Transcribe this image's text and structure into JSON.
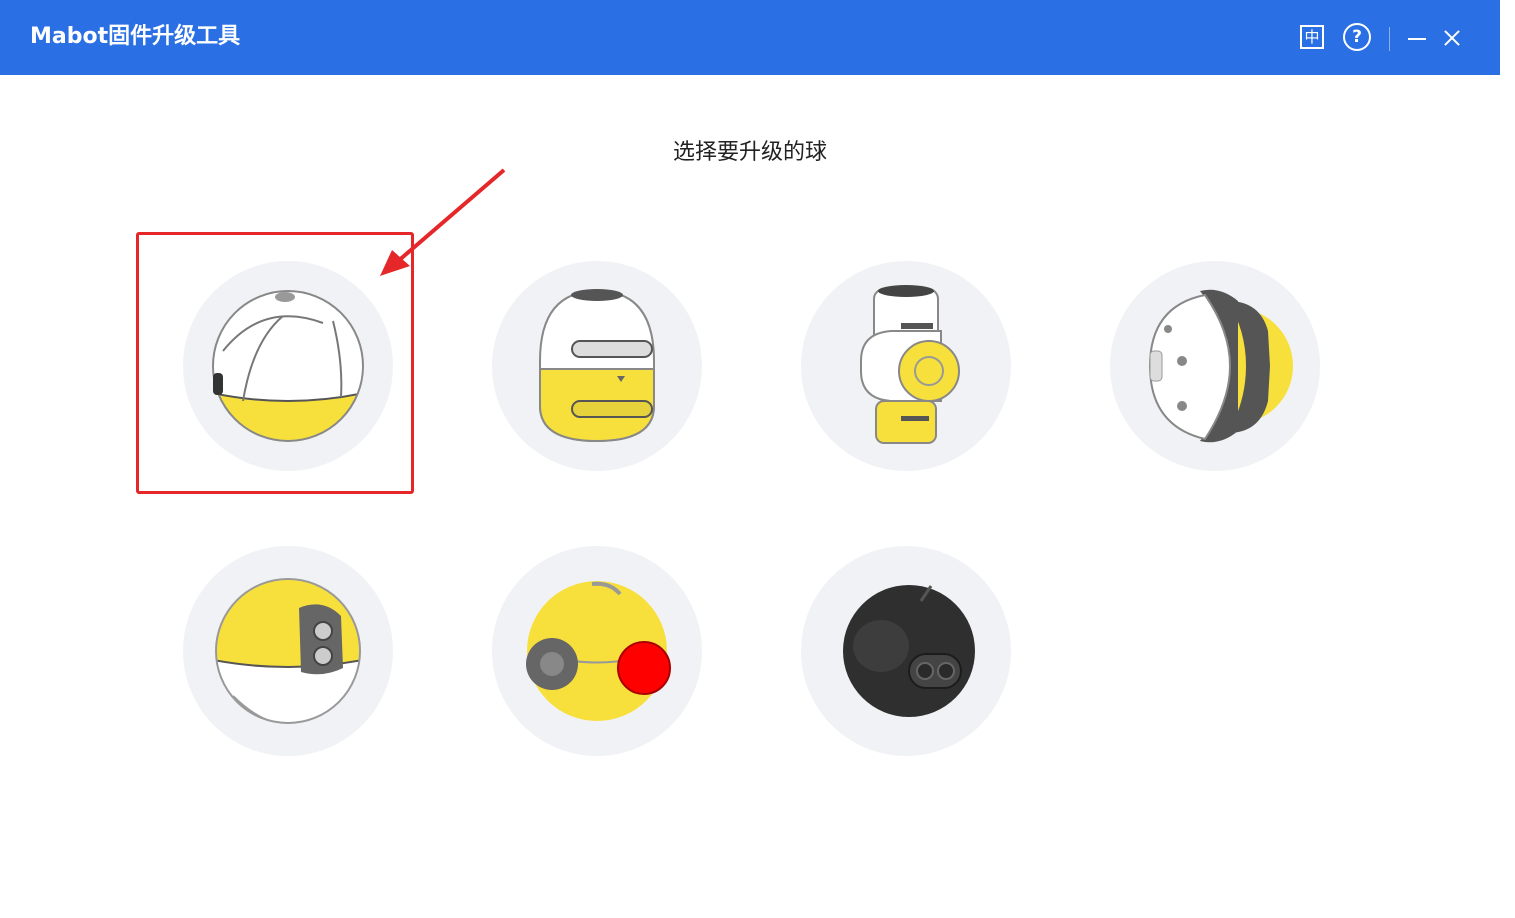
{
  "window": {
    "title": "Mabot固件升级工具",
    "language_button": "中",
    "help_button": "?"
  },
  "main": {
    "heading": "选择要升级的球"
  },
  "balls": [
    {
      "name": "main-control-ball",
      "selected": true
    },
    {
      "name": "drive-ball"
    },
    {
      "name": "servo-ball"
    },
    {
      "name": "wheel-ball"
    },
    {
      "name": "sensor-ball-dual-eye"
    },
    {
      "name": "light-ball-red"
    },
    {
      "name": "black-expression-ball"
    }
  ],
  "colors": {
    "titlebar": "#2a6fe3",
    "accent_yellow": "#f7e03c",
    "highlight": "#e6272a",
    "card_bg": "#f1f2f5"
  }
}
